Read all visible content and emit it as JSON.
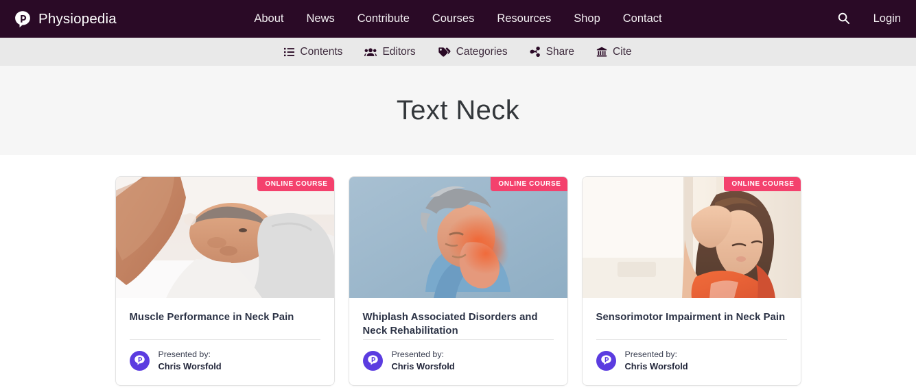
{
  "header": {
    "brand": "Physiopedia",
    "brand_logo_icon": "physiopedia-speech-bubble-p-icon",
    "background_color": "#2a0a26",
    "nav_items": [
      {
        "label": "About"
      },
      {
        "label": "News"
      },
      {
        "label": "Contribute"
      },
      {
        "label": "Courses"
      },
      {
        "label": "Resources"
      },
      {
        "label": "Shop"
      },
      {
        "label": "Contact"
      }
    ],
    "search_icon": "search-icon",
    "login_label": "Login"
  },
  "sub_nav": {
    "background_color": "#e9e9e9",
    "items": [
      {
        "label": "Contents",
        "icon": "list-icon"
      },
      {
        "label": "Editors",
        "icon": "users-icon"
      },
      {
        "label": "Categories",
        "icon": "tag-icon"
      },
      {
        "label": "Share",
        "icon": "share-icon"
      },
      {
        "label": "Cite",
        "icon": "bank-icon"
      }
    ]
  },
  "hero": {
    "title": "Text Neck",
    "background_color": "#f6f6f6"
  },
  "courses": {
    "badge_label": "ONLINE COURSE",
    "badge_color": "#f4416d",
    "presented_by_label": "Presented by:",
    "avatar_icon": "physiopedia-avatar-icon",
    "avatar_color": "#5b3ce0",
    "cards": [
      {
        "title": "Muscle Performance in Neck Pain",
        "presenter": "Chris Worsfold",
        "image_alt": "therapist-hands-treating-neck-of-reclining-patient"
      },
      {
        "title": "Whiplash Associated Disorders and Neck Rehabilitation",
        "presenter": "Chris Worsfold",
        "image_alt": "man-holding-sore-neck-on-blue-background"
      },
      {
        "title": "Sensorimotor Impairment in Neck Pain",
        "presenter": "Chris Worsfold",
        "image_alt": "woman-with-headache-leaning-by-bright-window"
      }
    ]
  }
}
